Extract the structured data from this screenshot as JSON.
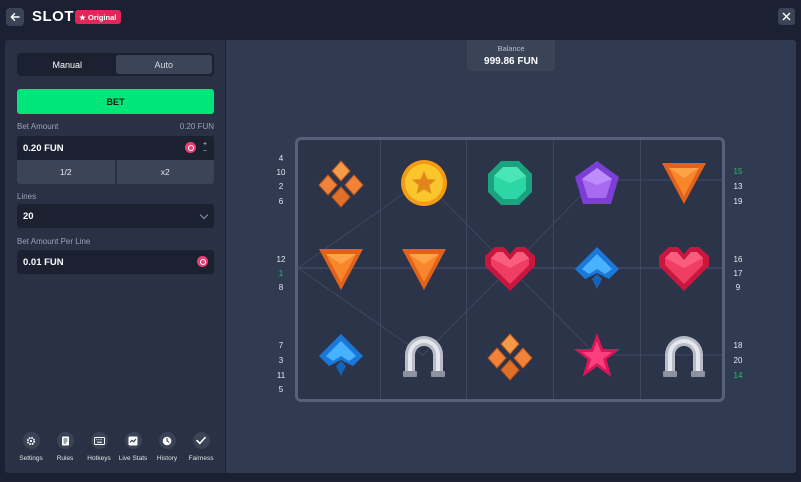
{
  "header": {
    "title": "SLOT",
    "badge": "Original"
  },
  "sidebar": {
    "tabs": [
      "Manual",
      "Auto"
    ],
    "active_tab": "Manual",
    "bet_button": "BET",
    "bet_amount": {
      "label": "Bet Amount",
      "right_value": "0.20 FUN",
      "value": "0.20 FUN",
      "step_up": "+",
      "step_down": "−"
    },
    "half_label": "1/2",
    "double_label": "x2",
    "lines": {
      "label": "Lines",
      "selected": "20"
    },
    "per_line": {
      "label": "Bet Amount Per Line",
      "value": "0.01 FUN"
    },
    "footer": [
      "Settings",
      "Rules",
      "Hotkeys",
      "Live Stats",
      "History",
      "Fairness"
    ]
  },
  "game": {
    "balance_label": "Balance",
    "balance_value": "999.86 FUN",
    "reels": [
      [
        "diamonds-orange",
        "coin-star-gold",
        "octagon-green",
        "pentagon-purple",
        "triangle-orange"
      ],
      [
        "triangle-orange",
        "triangle-orange",
        "heart-red",
        "spade-blue",
        "heart-red"
      ],
      [
        "spade-blue",
        "horseshoe-silver",
        "diamonds-orange",
        "star-pink",
        "horseshoe-silver"
      ]
    ],
    "left_line_numbers": [
      [
        "4",
        "10",
        "2",
        "6"
      ],
      [
        "12",
        "1",
        "8"
      ],
      [
        "7",
        "3",
        "11",
        "5"
      ]
    ],
    "right_line_numbers": [
      [
        "15",
        "13",
        "19"
      ],
      [
        "16",
        "17",
        "9"
      ],
      [
        "18",
        "20",
        "14"
      ]
    ],
    "highlighted_lines": [
      "1",
      "15",
      "14"
    ],
    "colors": {
      "accent_green": "#00e67a",
      "badge_red": "#e3265a",
      "highlight_green": "#19c46b"
    }
  }
}
